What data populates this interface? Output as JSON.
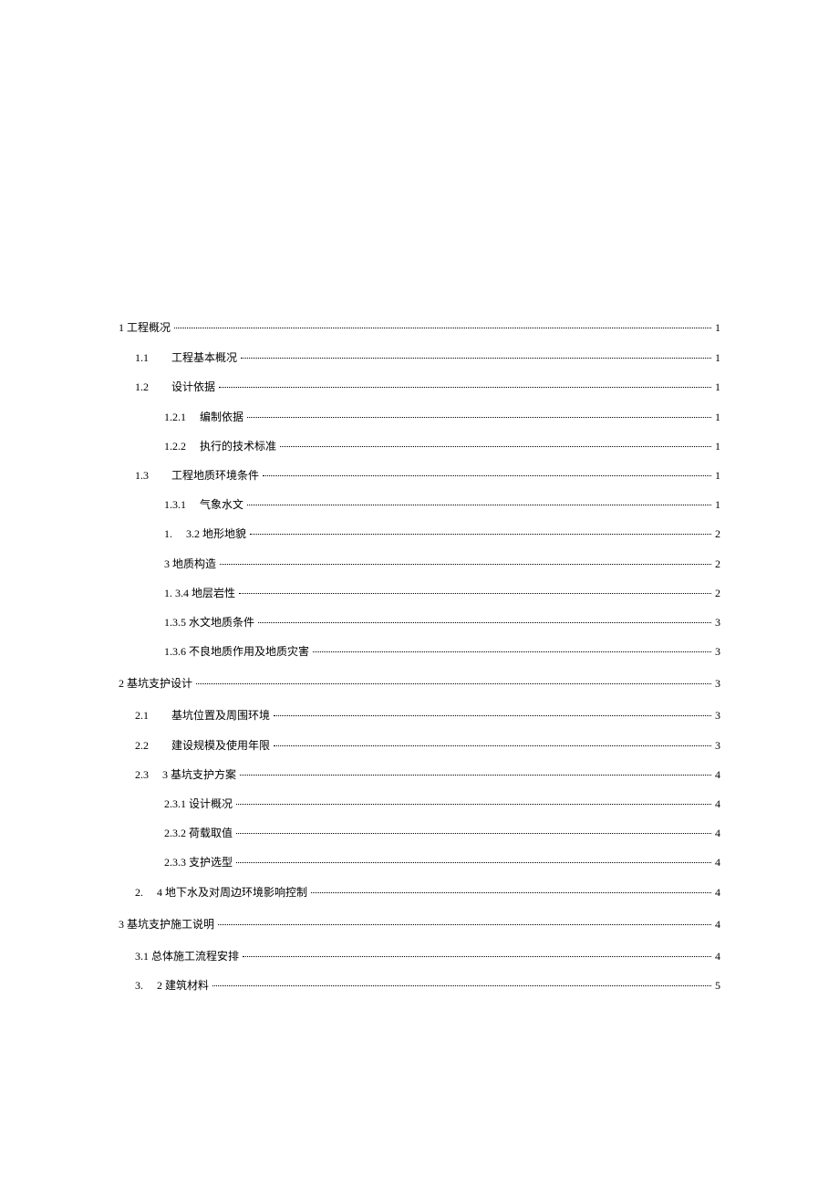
{
  "toc": [
    {
      "indent": "indent-0",
      "text": "1 工程概况",
      "page": "1",
      "gap": false
    },
    {
      "indent": "indent-1",
      "prefix": "1.1",
      "prefixGap": "num-gap-small",
      "text": "工程基本概况",
      "page": "1",
      "gapBefore": true
    },
    {
      "indent": "indent-1",
      "prefix": "1.2",
      "prefixGap": "num-gap-small",
      "text": "设计依据",
      "page": "1"
    },
    {
      "indent": "indent-2",
      "prefix": "1.2.1",
      "prefixGap": "num-gap-med",
      "text": "编制依据",
      "page": "1"
    },
    {
      "indent": "indent-2",
      "prefix": "1.2.2",
      "prefixGap": "num-gap-med",
      "text": "执行的技术标准",
      "page": "1"
    },
    {
      "indent": "indent-1",
      "prefix": "1.3",
      "prefixGap": "num-gap-small",
      "text": "工程地质环境条件",
      "page": "1"
    },
    {
      "indent": "indent-2",
      "prefix": "1.3.1",
      "prefixGap": "num-gap-med",
      "text": "气象水文",
      "page": "1"
    },
    {
      "indent": "indent-2",
      "prefix": "1.",
      "prefixGap": "num-gap-med",
      "text": "3.2 地形地貌",
      "page": "2"
    },
    {
      "indent": "indent-2b",
      "text": "3 地质构造",
      "page": "2"
    },
    {
      "indent": "indent-2b",
      "text": "1. 3.4 地层岩性",
      "page": "2"
    },
    {
      "indent": "indent-2b",
      "text": "1.3.5 水文地质条件",
      "page": "3"
    },
    {
      "indent": "indent-2b",
      "text": "1.3.6 不良地质作用及地质灾害",
      "page": "3"
    },
    {
      "indent": "indent-0",
      "text": "2 基坑支护设计",
      "page": "3",
      "sectionGap": true
    },
    {
      "indent": "indent-1",
      "prefix": "2.1",
      "prefixGap": "num-gap-small",
      "text": "基坑位置及周围环境",
      "page": "3",
      "gapBefore": true
    },
    {
      "indent": "indent-1",
      "prefix": "2.2",
      "prefixGap": "num-gap-small",
      "text": "建设规模及使用年限",
      "page": "3"
    },
    {
      "indent": "indent-1",
      "prefix": "2.3",
      "prefixGap": "num-gap-med",
      "text": "3 基坑支护方案",
      "page": "4"
    },
    {
      "indent": "indent-2b",
      "text": "2.3.1 设计概况",
      "page": "4"
    },
    {
      "indent": "indent-2b",
      "text": "2.3.2 荷载取值",
      "page": "4"
    },
    {
      "indent": "indent-2b",
      "text": "2.3.3 支护选型",
      "page": "4"
    },
    {
      "indent": "indent-1",
      "prefix": "2.",
      "prefixGap": "num-gap-med",
      "text": "4 地下水及对周边环境影响控制",
      "page": "4"
    },
    {
      "indent": "indent-0",
      "text": "3 基坑支护施工说明",
      "page": "4",
      "sectionGap": true
    },
    {
      "indent": "indent-1",
      "text": "3.1 总体施工流程安排",
      "page": "4",
      "gapBefore": true
    },
    {
      "indent": "indent-1",
      "prefix": "3.",
      "prefixGap": "num-gap-med",
      "text": "2 建筑材料",
      "page": "5"
    }
  ]
}
